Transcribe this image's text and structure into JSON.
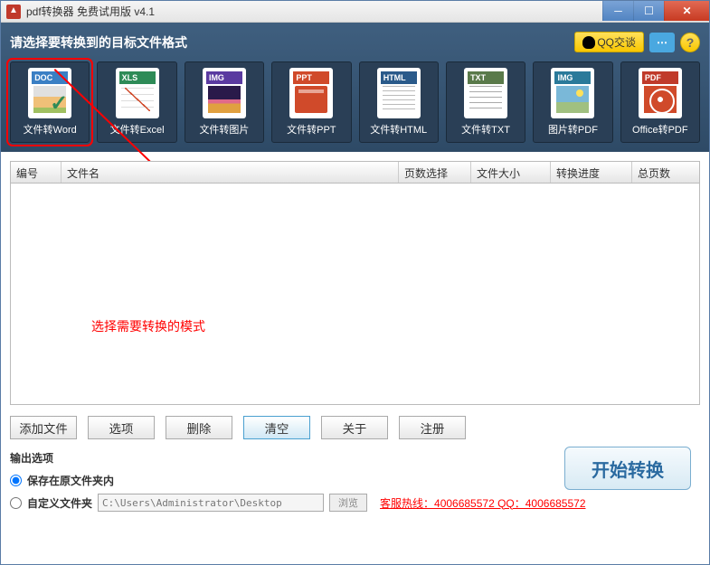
{
  "title": "pdf转换器 免费试用版 v4.1",
  "header": {
    "prompt": "请选择要转换到的目标文件格式",
    "qq_label": "QQ交谈",
    "chat_dots": "⋯",
    "help_label": "?"
  },
  "formats": [
    {
      "tag": "DOC",
      "label": "文件转Word"
    },
    {
      "tag": "XLS",
      "label": "文件转Excel"
    },
    {
      "tag": "IMG",
      "label": "文件转图片"
    },
    {
      "tag": "PPT",
      "label": "文件转PPT"
    },
    {
      "tag": "HTML",
      "label": "文件转HTML"
    },
    {
      "tag": "TXT",
      "label": "文件转TXT"
    },
    {
      "tag": "IMG",
      "label": "图片转PDF"
    },
    {
      "tag": "PDF",
      "label": "Office转PDF"
    }
  ],
  "table": {
    "columns": [
      "编号",
      "文件名",
      "页数选择",
      "文件大小",
      "转换进度",
      "总页数"
    ]
  },
  "annotation": "选择需要转换的模式",
  "buttons": {
    "add": "添加文件",
    "options": "选项",
    "delete": "删除",
    "clear": "清空",
    "about": "关于",
    "register": "注册"
  },
  "output": {
    "section_title": "输出选项",
    "save_original": "保存在原文件夹内",
    "custom_folder": "自定义文件夹",
    "path": "C:\\Users\\Administrator\\Desktop",
    "browse": "浏览",
    "hotline": "客服热线：4006685572 QQ：4006685572",
    "start": "开始转换"
  }
}
